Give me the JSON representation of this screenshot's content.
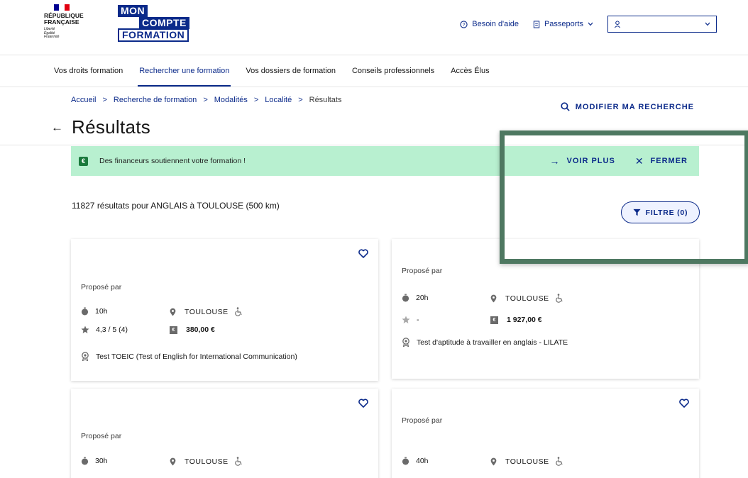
{
  "header": {
    "rf": {
      "line1": "RÉPUBLIQUE",
      "line2": "FRANÇAISE",
      "motto1": "Liberté",
      "motto2": "Égalité",
      "motto3": "Fraternité"
    },
    "mcf": {
      "top": "MON",
      "mid": "COMPTE",
      "bot": "FORMATION"
    },
    "help_label": "Besoin d'aide",
    "passports_label": "Passeports",
    "user_value": ""
  },
  "nav": {
    "items": [
      {
        "label": "Vos droits formation"
      },
      {
        "label": "Rechercher une formation"
      },
      {
        "label": "Vos dossiers de formation"
      },
      {
        "label": "Conseils professionnels"
      },
      {
        "label": "Accès Élus"
      }
    ],
    "active_index": 1
  },
  "breadcrumb": {
    "items": [
      "Accueil",
      "Recherche de formation",
      "Modalités",
      "Localité",
      "Résultats"
    ]
  },
  "modify_search_label": "MODIFIER MA RECHERCHE",
  "page_title": "Résultats",
  "banner": {
    "icon_label": "€",
    "text": "Des financeurs soutiennent votre formation !",
    "see_more_label": "VOIR PLUS",
    "close_label": "FERMER"
  },
  "results_text": "11827 résultats pour ANGLAIS à TOULOUSE (500 km)",
  "filter_label": "FILTRE (0)",
  "cards": [
    {
      "proposed": "Proposé par",
      "duration": "10h",
      "city": "TOULOUSE",
      "rating": "4,3 / 5 (4)",
      "price": "380,00 €",
      "certification": "Test TOEIC (Test of English for International Communication)"
    },
    {
      "proposed": "Proposé par",
      "duration": "20h",
      "city": "TOULOUSE",
      "rating": "-",
      "price": "1 927,00 €",
      "certification": "Test d'aptitude à travailler en anglais - LILATE"
    },
    {
      "proposed": "Proposé par",
      "duration": "30h",
      "city": "TOULOUSE"
    },
    {
      "proposed": "Proposé par",
      "duration": "40h",
      "city": "TOULOUSE"
    }
  ],
  "colors": {
    "brand": "#0b2a8a",
    "banner_bg": "#b8f0d0",
    "highlight": "#4e7861"
  }
}
